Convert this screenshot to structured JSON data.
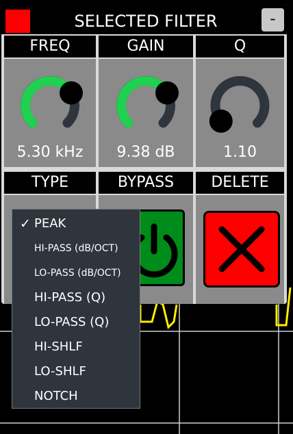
{
  "colors": {
    "background": "#000000",
    "panel": "#d9d9d9",
    "cell": "#8a8a8a",
    "accent_green": "#20d050",
    "track": "#2e353d",
    "filter_swatch": "#ff0000",
    "plot_line": "#ffee00",
    "grid": "#cccccc"
  },
  "header": {
    "title": "SELECTED FILTER",
    "minimize_label": "-"
  },
  "controls": {
    "freq": {
      "label": "FREQ",
      "value": "5.30 kHz",
      "level": 0.72
    },
    "gain": {
      "label": "GAIN",
      "value": "9.38 dB",
      "level": 0.72
    },
    "q": {
      "label": "Q",
      "value": "1.10",
      "level": 0.02
    }
  },
  "actions": {
    "type_label": "TYPE",
    "bypass_label": "BYPASS",
    "delete_label": "DELETE",
    "bypass_icon": "power-icon",
    "delete_icon": "close-x-icon"
  },
  "type_menu": {
    "selected_mark": "✓",
    "items": [
      "PEAK",
      "HI-PASS (dB/OCT)",
      "LO-PASS (dB/OCT)",
      "HI-PASS (Q)",
      "LO-PASS (Q)",
      "HI-SHLF",
      "LO-SHLF",
      "NOTCH"
    ]
  }
}
